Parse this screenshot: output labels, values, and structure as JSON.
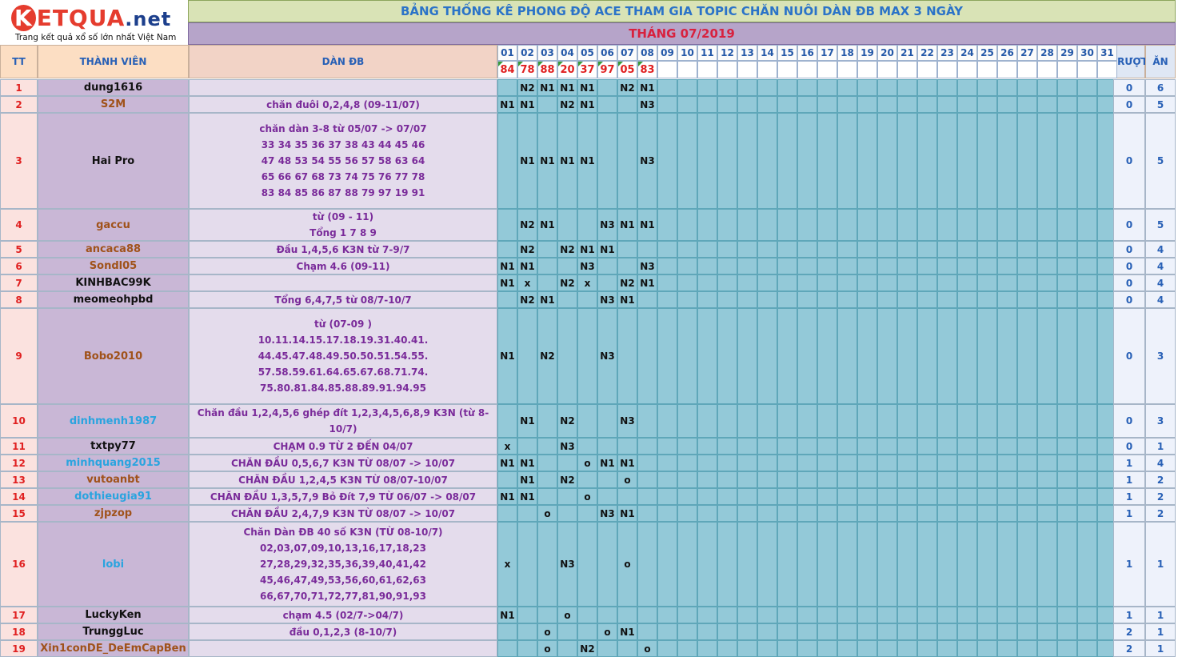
{
  "logo": {
    "brand_k": "K",
    "brand_rest": "ETQUA",
    "brand_tld": ".net",
    "tagline": "Trang kết quả xổ số lớn nhất Việt Nam"
  },
  "title": "BẢNG THỐNG KÊ PHONG ĐỘ ACE THAM GIA TOPIC CHĂN NUÔI DÀN ĐB MAX 3 NGÀY",
  "month": "THÁNG 07/2019",
  "headers": {
    "tt": "TT",
    "member": "THÀNH VIÊN",
    "dan": "DÀN ĐB",
    "truot": "TRƯỢT",
    "an": "ĂN"
  },
  "days": [
    "01",
    "02",
    "03",
    "04",
    "05",
    "06",
    "07",
    "08",
    "09",
    "10",
    "11",
    "12",
    "13",
    "14",
    "15",
    "16",
    "17",
    "18",
    "19",
    "20",
    "21",
    "22",
    "23",
    "24",
    "25",
    "26",
    "27",
    "28",
    "29",
    "30",
    "31"
  ],
  "results": [
    "84",
    "78",
    "88",
    "20",
    "37",
    "97",
    "05",
    "83",
    "",
    "",
    "",
    "",
    "",
    "",
    "",
    "",
    "",
    "",
    "",
    "",
    "",
    "",
    "",
    "",
    "",
    "",
    "",
    "",
    "",
    "",
    ""
  ],
  "colors": {
    "brown": "#a0521a",
    "black": "#111111",
    "blue": "#2aa4df",
    "red": "#e02020",
    "purple": "#7a2b9a"
  },
  "rows": [
    {
      "tt": "1",
      "name": "dung1616",
      "color": "black",
      "dan": [],
      "marks": [
        "",
        "N2",
        "N1",
        "N1",
        "N1",
        "",
        "N2",
        "N1"
      ],
      "truot": "0",
      "an": "6"
    },
    {
      "tt": "2",
      "name": "S2M",
      "color": "brown",
      "dan": [
        "chăn đuôi 0,2,4,8 (09-11/07)"
      ],
      "marks": [
        "N1",
        "N1",
        "",
        "N2",
        "N1",
        "",
        "",
        "N3"
      ],
      "truot": "0",
      "an": "5"
    },
    {
      "tt": "3",
      "name": "Hai Pro",
      "color": "black",
      "dan": [
        "chăn dàn 3-8 từ 05/07 -> 07/07",
        "33 34 35 36 37 38 43 44 45 46",
        "47 48 53 54 55 56 57 58 63 64",
        "65 66 67 68 73 74 75 76 77 78",
        "83 84 85 86 87 88 79 97 19 91"
      ],
      "marks": [
        "",
        "N1",
        "N1",
        "N1",
        "N1",
        "",
        "",
        "N3"
      ],
      "truot": "0",
      "an": "5"
    },
    {
      "tt": "4",
      "name": "gaccu",
      "color": "brown",
      "dan": [
        "từ (09 - 11)",
        "Tổng 1 7 8 9"
      ],
      "marks": [
        "",
        "N2",
        "N1",
        "",
        "",
        "N3",
        "N1",
        "N1"
      ],
      "truot": "0",
      "an": "5"
    },
    {
      "tt": "5",
      "name": "ancaca88",
      "color": "brown",
      "dan": [
        "Đầu 1,4,5,6 K3N từ 7-9/7"
      ],
      "marks": [
        "",
        "N2",
        "",
        "N2",
        "N1",
        "N1",
        "",
        ""
      ],
      "truot": "0",
      "an": "4"
    },
    {
      "tt": "6",
      "name": "Sondl05",
      "color": "brown",
      "dan": [
        "Chạm 4.6 (09-11)"
      ],
      "marks": [
        "N1",
        "N1",
        "",
        "",
        "N3",
        "",
        "",
        "N3"
      ],
      "truot": "0",
      "an": "4"
    },
    {
      "tt": "7",
      "name": "KINHBAC99K",
      "color": "black",
      "dan": [],
      "marks": [
        "N1",
        "x",
        "",
        "N2",
        "x",
        "",
        "N2",
        "N1"
      ],
      "truot": "0",
      "an": "4"
    },
    {
      "tt": "8",
      "name": "meomeohpbd",
      "color": "black",
      "dan": [
        "Tổng 6,4,7,5 từ 08/7-10/7"
      ],
      "marks": [
        "",
        "N2",
        "N1",
        "",
        "",
        "N3",
        "N1",
        ""
      ],
      "truot": "0",
      "an": "4"
    },
    {
      "tt": "9",
      "name": "Bobo2010",
      "color": "brown",
      "dan": [
        "từ (07-09 )",
        "10.11.14.15.17.18.19.31.40.41.",
        "44.45.47.48.49.50.50.51.54.55.",
        "57.58.59.61.64.65.67.68.71.74.",
        "75.80.81.84.85.88.89.91.94.95"
      ],
      "marks": [
        "N1",
        "",
        "N2",
        "",
        "",
        "N3",
        "",
        ""
      ],
      "truot": "0",
      "an": "3"
    },
    {
      "tt": "10",
      "name": "dinhmenh1987",
      "color": "blue",
      "dan": [
        "Chăn đầu 1,2,4,5,6 ghép đít 1,2,3,4,5,6,8,9 K3N (từ 8-",
        "10/7)"
      ],
      "marks": [
        "",
        "N1",
        "",
        "N2",
        "",
        "",
        "N3",
        ""
      ],
      "truot": "0",
      "an": "3"
    },
    {
      "tt": "11",
      "name": "txtpy77",
      "color": "black",
      "dan": [
        "CHẠM 0.9 TỪ 2 ĐẾN 04/07"
      ],
      "marks": [
        "x",
        "",
        "",
        "N3",
        "",
        "",
        "",
        ""
      ],
      "truot": "0",
      "an": "1"
    },
    {
      "tt": "12",
      "name": "minhquang2015",
      "color": "blue",
      "dan": [
        "CHĂN ĐẦU 0,5,6,7 K3N TỪ 08/07 -> 10/07"
      ],
      "marks": [
        "N1",
        "N1",
        "",
        "",
        "o",
        "N1",
        "N1",
        ""
      ],
      "truot": "1",
      "an": "4"
    },
    {
      "tt": "13",
      "name": "vutoanbt",
      "color": "brown",
      "dan": [
        "CHĂN ĐẦU 1,2,4,5 K3N TỪ 08/07-10/07"
      ],
      "marks": [
        "",
        "N1",
        "",
        "N2",
        "",
        "",
        "o",
        ""
      ],
      "truot": "1",
      "an": "2"
    },
    {
      "tt": "14",
      "name": "dothieugia91",
      "color": "blue",
      "dan": [
        "CHĂN ĐẦU 1,3,5,7,9 Bỏ Đít 7,9 TỪ 06/07 -> 08/07"
      ],
      "marks": [
        "N1",
        "N1",
        "",
        "",
        "o",
        "",
        "",
        ""
      ],
      "truot": "1",
      "an": "2"
    },
    {
      "tt": "15",
      "name": "zjpzop",
      "color": "brown",
      "dan": [
        "CHĂN ĐẦU 2,4,7,9 K3N TỪ 08/07 -> 10/07"
      ],
      "marks": [
        "",
        "",
        "o",
        "",
        "",
        "N3",
        "N1",
        ""
      ],
      "truot": "1",
      "an": "2"
    },
    {
      "tt": "16",
      "name": "lobi",
      "color": "blue",
      "dan": [
        "Chăn Dàn ĐB 40 số K3N (TỪ 08-10/7)",
        "02,03,07,09,10,13,16,17,18,23",
        "27,28,29,32,35,36,39,40,41,42",
        "45,46,47,49,53,56,60,61,62,63",
        "66,67,70,71,72,77,81,90,91,93"
      ],
      "marks": [
        "x",
        "",
        "",
        "N3",
        "",
        "",
        "o",
        ""
      ],
      "truot": "1",
      "an": "1"
    },
    {
      "tt": "17",
      "name": "LuckyKen",
      "color": "black",
      "dan": [
        "chạm 4.5 (02/7->04/7)"
      ],
      "marks": [
        "N1",
        "",
        "",
        "o",
        "",
        "",
        "",
        ""
      ],
      "truot": "1",
      "an": "1"
    },
    {
      "tt": "18",
      "name": "TrunggLuc",
      "color": "black",
      "dan": [
        "đầu 0,1,2,3 (8-10/7)"
      ],
      "marks": [
        "",
        "",
        "o",
        "",
        "",
        "o",
        "N1",
        ""
      ],
      "truot": "2",
      "an": "1"
    },
    {
      "tt": "19",
      "name": "Xin1conDE_DeEmCapBen",
      "color": "brown",
      "dan": [],
      "marks": [
        "",
        "",
        "o",
        "",
        "N2",
        "",
        "",
        "o"
      ],
      "truot": "2",
      "an": "1"
    }
  ]
}
